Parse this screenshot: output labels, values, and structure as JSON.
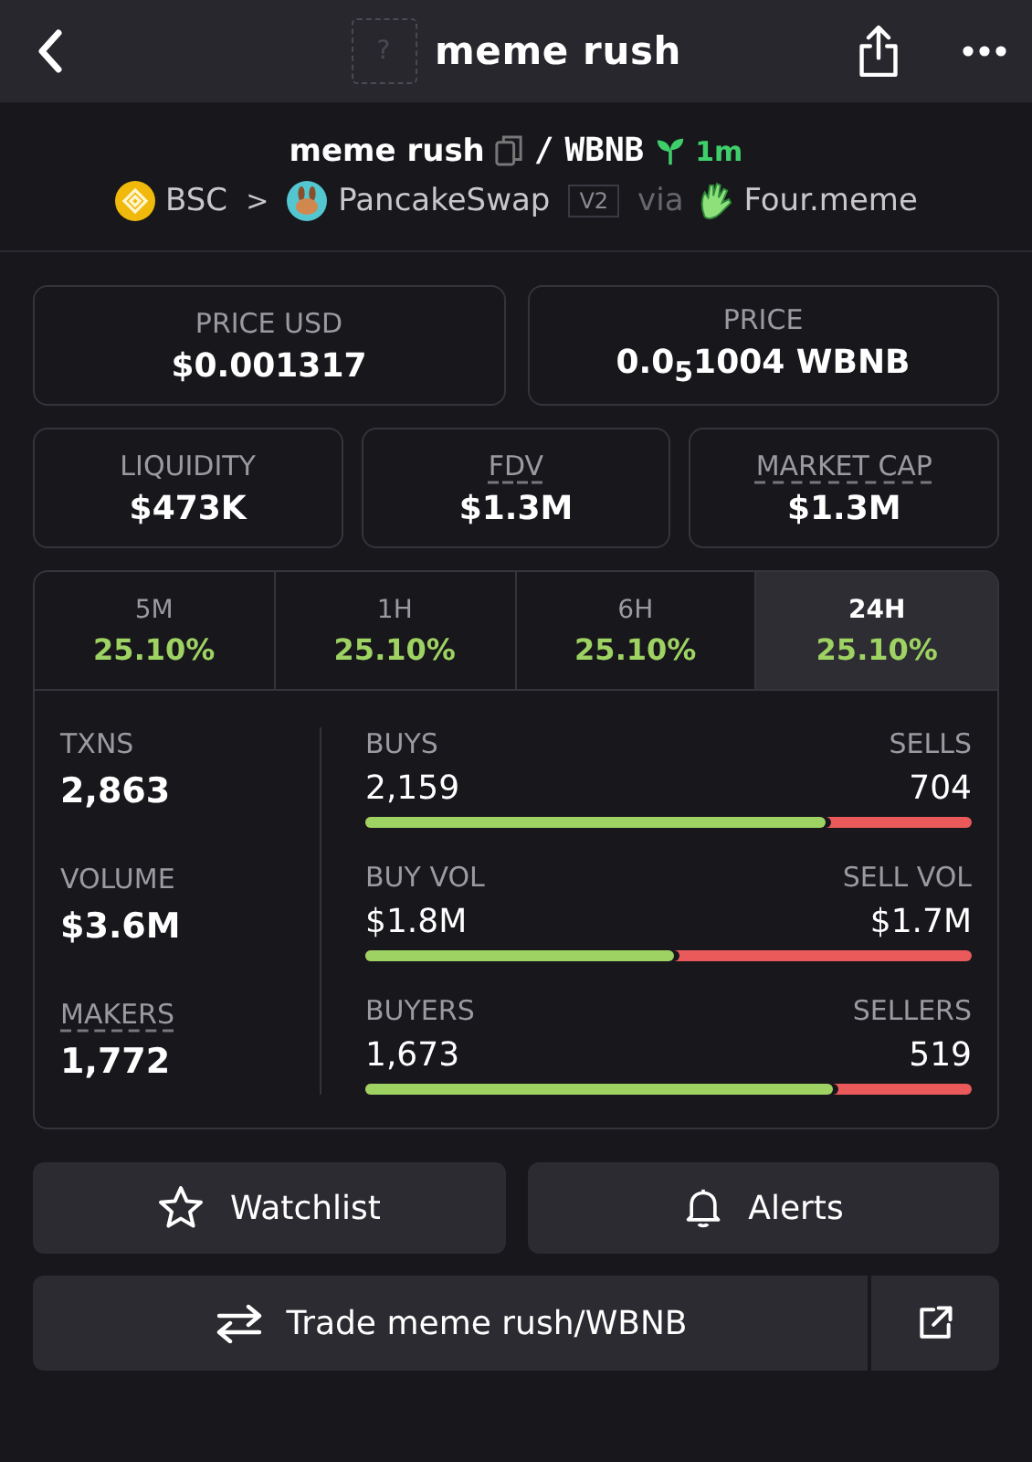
{
  "top_bar": {
    "placeholder_glyph": "?",
    "title": "meme rush"
  },
  "pair": {
    "base": "meme rush",
    "separator": "/",
    "quote": "WBNB",
    "age": "1m"
  },
  "route": {
    "chain": "BSC",
    "chevron": ">",
    "dex": "PancakeSwap",
    "version": "V2",
    "via": "via",
    "launchpad": "Four.meme"
  },
  "price_cards": [
    {
      "label": "PRICE USD",
      "value": "$0.001317",
      "dotted_underline": false
    },
    {
      "label": "PRICE",
      "value": "0.0$_{5}$1004 WBNB",
      "dotted_underline": false
    }
  ],
  "metric_cards": [
    {
      "label": "LIQUIDITY",
      "value": "$473K",
      "dotted_underline": false
    },
    {
      "label": "FDV",
      "value": "$1.3M",
      "dotted_underline": true
    },
    {
      "label": "MARKET CAP",
      "value": "$1.3M",
      "dotted_underline": true
    }
  ],
  "timeframes": [
    {
      "label": "5M",
      "change": "25.10%",
      "selected": false
    },
    {
      "label": "1H",
      "change": "25.10%",
      "selected": false
    },
    {
      "label": "6H",
      "change": "25.10%",
      "selected": false
    },
    {
      "label": "24H",
      "change": "25.10%",
      "selected": true
    }
  ],
  "totals": [
    {
      "label": "TXNS",
      "value": "2,863",
      "dotted_underline": false
    },
    {
      "label": "VOLUME",
      "value": "$3.6M",
      "dotted_underline": false
    },
    {
      "label": "MAKERS",
      "value": "1,772",
      "dotted_underline": true
    }
  ],
  "splits": [
    {
      "left_label": "BUYS",
      "right_label": "SELLS",
      "left_value": "2,159",
      "right_value": "704",
      "level": 0.76
    },
    {
      "left_label": "BUY VOL",
      "right_label": "SELL VOL",
      "left_value": "$1.8M",
      "right_value": "$1.7M",
      "level": 0.51
    },
    {
      "left_label": "BUYERS",
      "right_label": "SELLERS",
      "left_value": "1,673",
      "right_value": "519",
      "level": 0.77
    }
  ],
  "actions": [
    {
      "label": "Watchlist",
      "kind": "watchlist"
    },
    {
      "label": "Alerts",
      "kind": "alerts"
    }
  ],
  "trade_button": {
    "label": "Trade meme rush/WBNB"
  }
}
